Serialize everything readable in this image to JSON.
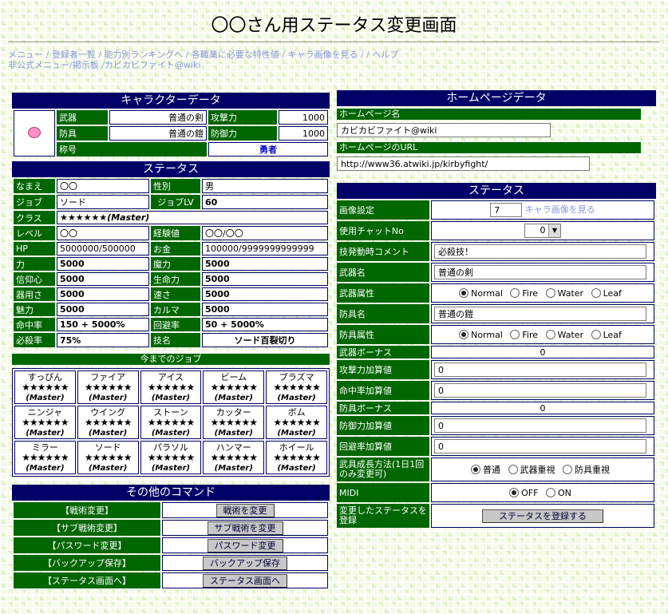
{
  "page_title": "〇〇さん用ステータス変更画面",
  "nav": {
    "line1": [
      "メニュー",
      "登録者一覧",
      "能力別ランキングへ",
      "各職業に必要な特性値",
      "キャラ画像を見る",
      "",
      "ヘルプ"
    ],
    "line2": [
      "非公式メニュー",
      "掲示板",
      "カビカビファイト@wiki"
    ]
  },
  "character": {
    "header": "キャラクターデータ",
    "weapon_label": "武器",
    "weapon": "普通の剣",
    "attack_label": "攻撃力",
    "attack": "1000",
    "armor_label": "防具",
    "armor": "普通の鎧",
    "defense_label": "防御力",
    "defense": "1000",
    "title_label": "称号",
    "title": "勇者"
  },
  "status": {
    "header": "ステータス",
    "rows": [
      {
        "l1": "なまえ",
        "v1": "〇〇",
        "l2": "性別",
        "v2": "男"
      },
      {
        "l1": "ジョブ",
        "v1": "ソード",
        "l2": "ジョブLV",
        "v2": "60"
      },
      {
        "l1": "クラス",
        "v1": "★★★★★★(Master)"
      },
      {
        "l1": "レベル",
        "v1": "〇〇",
        "l2": "経験値",
        "v2": "〇〇/〇〇"
      },
      {
        "l1": "HP",
        "v1": "5000000/500000",
        "l2": "お金",
        "v2": "100000/9999999999999"
      },
      {
        "l1": "力",
        "v1": "5000",
        "l2": "魔力",
        "v2": "5000"
      },
      {
        "l1": "信仰心",
        "v1": "5000",
        "l2": "生命力",
        "v2": "5000"
      },
      {
        "l1": "器用さ",
        "v1": "5000",
        "l2": "速さ",
        "v2": "5000"
      },
      {
        "l1": "魅力",
        "v1": "5000",
        "l2": "カルマ",
        "v2": "5000"
      },
      {
        "l1": "命中率",
        "v1": "150 + 5000%",
        "l2": "回避率",
        "v2": "50 + 5000%"
      },
      {
        "l1": "必殺率",
        "v1": "75%",
        "l2": "技名",
        "v2": "ソード百裂切り"
      }
    ]
  },
  "jobs": {
    "header": "今までのジョブ",
    "stars": "★★★★★★",
    "master": "(Master)",
    "names": [
      "すっぴん",
      "ファイア",
      "アイス",
      "ビーム",
      "プラズマ",
      "ニンジャ",
      "ウイング",
      "ストーン",
      "カッター",
      "ボム",
      "ミラー",
      "ソード",
      "パラソル",
      "ハンマー",
      "ホイール"
    ]
  },
  "commands": {
    "header": "その他のコマンド",
    "items": [
      {
        "label": "【戦術変更】",
        "button": "戦術を変更"
      },
      {
        "label": "【サブ戦術変更】",
        "button": "サブ戦術を変更"
      },
      {
        "label": "【パスワード変更】",
        "button": "パスワード変更"
      },
      {
        "label": "【バックアップ保存】",
        "button": "バックアップ保存"
      },
      {
        "label": "【ステータス画面へ】",
        "button": "ステータス画面へ"
      }
    ]
  },
  "homepage": {
    "header": "ホームページデータ",
    "name_label": "ホームページ名",
    "name_value": "カビカビファイト@wiki",
    "url_label": "ホームページのURL",
    "url_value": "http://www36.atwiki.jp/kirbyfight/"
  },
  "edit": {
    "header": "ステータス",
    "image_label": "画像設定",
    "image_value": "7",
    "image_link": "キャラ画像を見る",
    "chat_label": "使用チャットNo",
    "chat_value": "0",
    "skill_comment_label": "技発動時コメント",
    "skill_comment_value": "必殺技！",
    "weapon_name_label": "武器名",
    "weapon_name_value": "普通の剣",
    "weapon_attr_label": "武器属性",
    "armor_name_label": "防具名",
    "armor_name_value": "普通の鎧",
    "armor_attr_label": "防具属性",
    "attrs": [
      "Normal",
      "Fire",
      "Water",
      "Leaf"
    ],
    "weapon_bonus_label": "武器ボーナス",
    "weapon_bonus": "0",
    "atk_add_label": "攻撃力加算値",
    "atk_add": "0",
    "hit_add_label": "命中率加算値",
    "hit_add": "0",
    "armor_bonus_label": "防具ボーナス",
    "armor_bonus": "0",
    "def_add_label": "防御力加算値",
    "def_add": "0",
    "eva_add_label": "回避率加算値",
    "eva_add": "0",
    "growth_label": "武具成長方法(1日1回のみ変更可)",
    "growth_opts": [
      "普通",
      "武器重視",
      "防具重視"
    ],
    "midi_label": "MIDI",
    "midi_opts": [
      "OFF",
      "ON"
    ],
    "register_label": "変更したステータスを登録",
    "register_button": "ステータスを登録する"
  },
  "colors": {
    "header_blue": "#000066",
    "label_green": "#006600",
    "nav_link": "#8a97dd"
  }
}
